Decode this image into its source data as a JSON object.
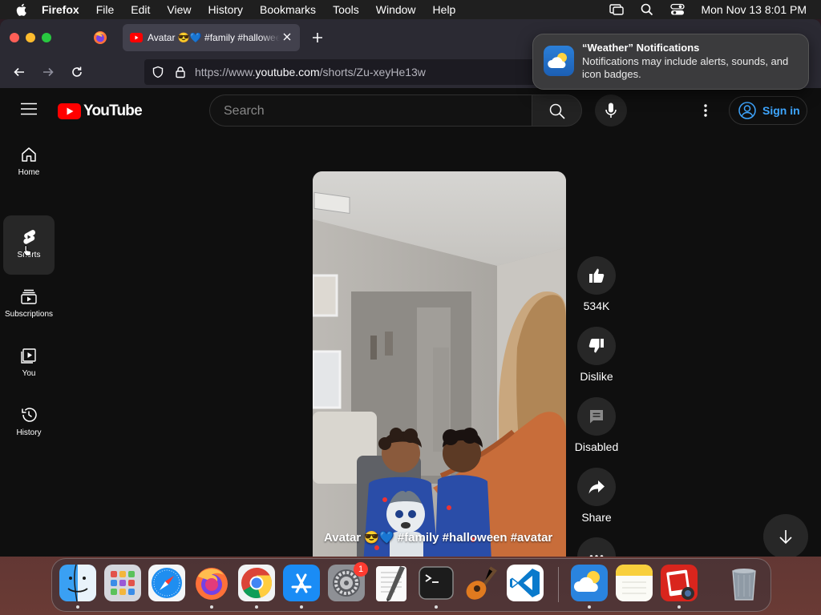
{
  "menubar": {
    "app_name": "Firefox",
    "items": [
      "File",
      "Edit",
      "View",
      "History",
      "Bookmarks",
      "Tools",
      "Window",
      "Help"
    ],
    "clock": "Mon Nov 13  8:01 PM"
  },
  "browser": {
    "active_tab": {
      "title": "Avatar 😎💙 #family #halloween #avatar - YouTube",
      "favicon": "youtube-icon"
    },
    "url": {
      "prefix": "https://www.",
      "domain": "youtube.com",
      "path": "/shorts/Zu-xeyHe13w"
    }
  },
  "notification": {
    "title": "“Weather” Notifications",
    "body": "Notifications may include alerts, sounds, and icon badges."
  },
  "youtube": {
    "logo_text": "YouTube",
    "search_placeholder": "Search",
    "signin_label": "Sign in",
    "sidebar": [
      {
        "label": "Home",
        "icon": "home-icon"
      },
      {
        "label": "Shorts",
        "icon": "shorts-icon",
        "active": true
      },
      {
        "label": "Subscriptions",
        "icon": "subscriptions-icon"
      },
      {
        "label": "You",
        "icon": "you-icon"
      },
      {
        "label": "History",
        "icon": "history-icon"
      }
    ],
    "short": {
      "caption": "Avatar 😎💙 #family #halloween #avatar"
    },
    "actions": {
      "like_count": "534K",
      "dislike_label": "Dislike",
      "comments_label": "Disabled",
      "share_label": "Share"
    }
  },
  "dock": {
    "apps": [
      "Finder",
      "Launchpad",
      "Safari",
      "Firefox",
      "Chrome",
      "App Store",
      "System Settings",
      "TextEdit",
      "Terminal",
      "GarageBand",
      "Visual Studio Code",
      "Weather",
      "Notes",
      "Photo Booth",
      "Trash"
    ],
    "settings_badge": "1"
  }
}
